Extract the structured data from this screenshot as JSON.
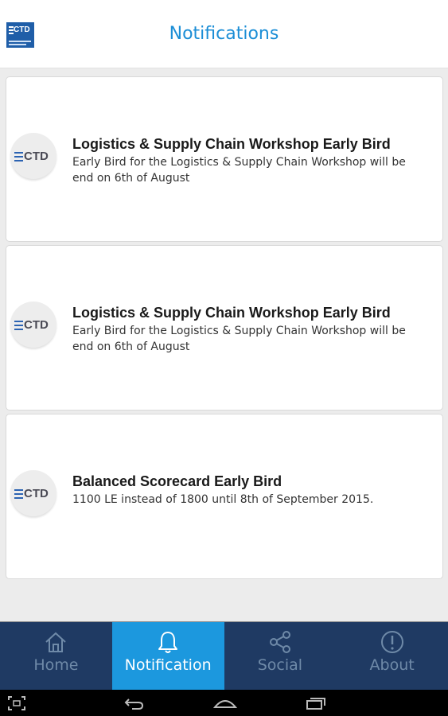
{
  "app": {
    "logo_text": "CTD",
    "title": "Notifications"
  },
  "notifications": [
    {
      "avatar_text": "CTD",
      "title": "Logistics & Supply Chain Workshop Early Bird",
      "body": "Early Bird for the Logistics & Supply Chain Workshop will be end on 6th of August"
    },
    {
      "avatar_text": "CTD",
      "title": "Logistics & Supply Chain Workshop Early Bird",
      "body": "Early Bird for the Logistics & Supply Chain Workshop will be end on 6th of August"
    },
    {
      "avatar_text": "CTD",
      "title": "Balanced Scorecard Early Bird",
      "body": "1100 LE instead of 1800 until 8th of September 2015."
    }
  ],
  "nav": {
    "items": [
      {
        "label": "Home",
        "icon": "home-icon",
        "active": false
      },
      {
        "label": "Notification",
        "icon": "bell-icon",
        "active": true
      },
      {
        "label": "Social",
        "icon": "share-icon",
        "active": false
      },
      {
        "label": "About",
        "icon": "info-icon",
        "active": false
      }
    ]
  },
  "colors": {
    "accent": "#1c8ed6",
    "nav_bg": "#1f3a63",
    "nav_active": "#1c98de",
    "nav_inactive_text": "#6f8aa8"
  }
}
